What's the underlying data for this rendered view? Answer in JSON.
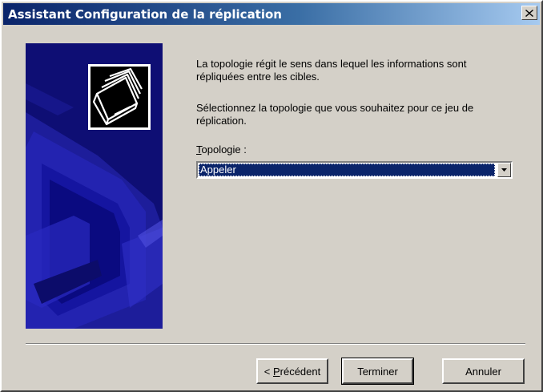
{
  "window": {
    "title": "Assistant Configuration de la réplication",
    "close_glyph": "×"
  },
  "content": {
    "paragraph1": "La topologie régit le sens dans lequel les informations sont répliquées entre les cibles.",
    "paragraph2": "Sélectionnez la topologie que vous souhaitez pour ce jeu de réplication.",
    "topology_label_mnemonic": "T",
    "topology_label_rest": "opologie :",
    "topology_value": "Appeler"
  },
  "buttons": {
    "previous_prefix": "< ",
    "previous_mnemonic": "P",
    "previous_rest": "récédent",
    "finish": "Terminer",
    "cancel": "Annuler"
  },
  "colors": {
    "titlebar_start": "#0a246a",
    "titlebar_end": "#a6caf0",
    "dialog_face": "#d4d0c8",
    "side_panel": "#0e0e74",
    "selection": "#0a246a"
  },
  "icons": {
    "wizard_logo": "folders-icon",
    "close": "close-icon",
    "dropdown": "chevron-down-icon"
  }
}
